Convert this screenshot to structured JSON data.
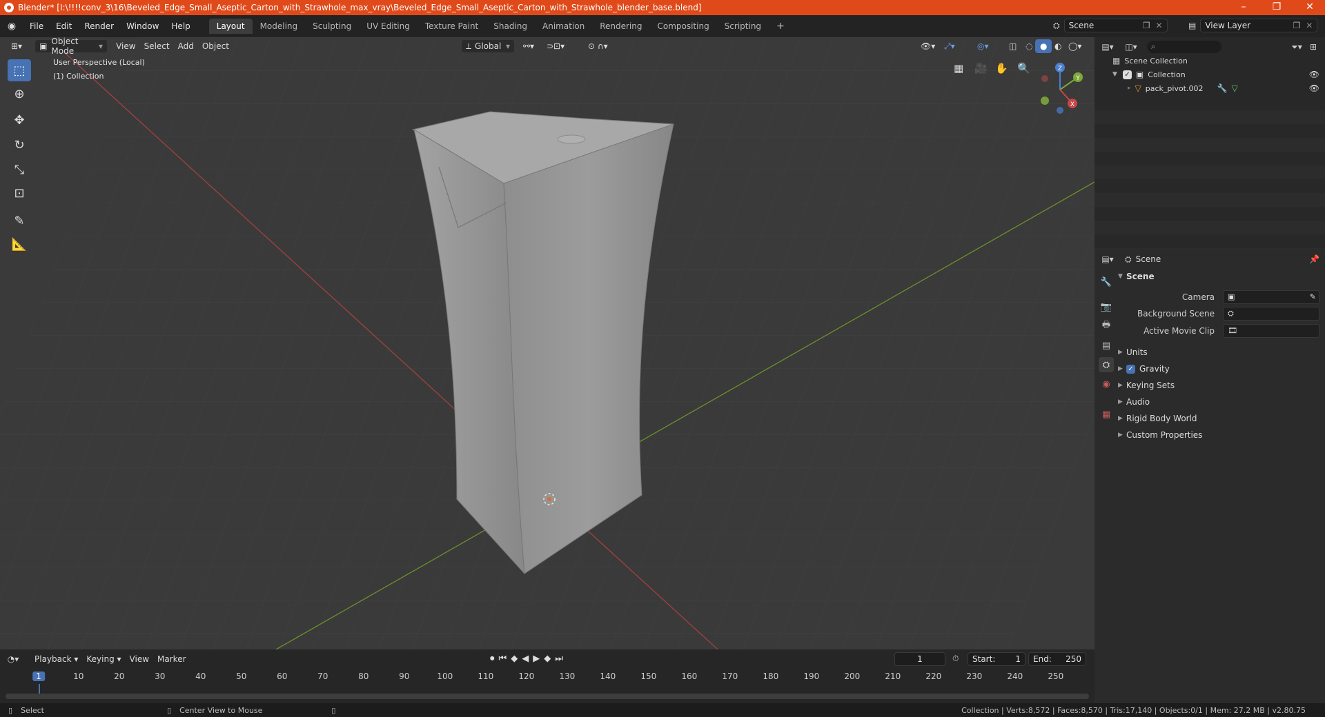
{
  "window": {
    "title": "Blender* [I:\\!!!!conv_3\\16\\Beveled_Edge_Small_Aseptic_Carton_with_Strawhole_max_vray\\Beveled_Edge_Small_Aseptic_Carton_with_Strawhole_blender_base.blend]",
    "minimize": "–",
    "maximize": "❐",
    "close": "✕"
  },
  "menu": [
    "File",
    "Edit",
    "Render",
    "Window",
    "Help"
  ],
  "workspaces": [
    "Layout",
    "Modeling",
    "Sculpting",
    "UV Editing",
    "Texture Paint",
    "Shading",
    "Animation",
    "Rendering",
    "Compositing",
    "Scripting"
  ],
  "active_workspace": "Layout",
  "add_workspace": "+",
  "scene_selector": "Scene",
  "view_layer": "View Layer",
  "viewport": {
    "mode": "Object Mode",
    "menus": [
      "View",
      "Select",
      "Add",
      "Object"
    ],
    "orientation": "Global",
    "info_line1": "User Perspective (Local)",
    "info_line2": "(1) Collection",
    "gizmo": {
      "z": "Z",
      "y": "Y",
      "x": "X"
    }
  },
  "outliner": {
    "root": "Scene Collection",
    "collection": "Collection",
    "object": "pack_pivot.002",
    "search_placeholder": ""
  },
  "properties": {
    "header": "Scene",
    "panel": "Scene",
    "fields": [
      {
        "label": "Camera"
      },
      {
        "label": "Background Scene"
      },
      {
        "label": "Active Movie Clip"
      }
    ],
    "subpanels": [
      "Units",
      "Gravity",
      "Keying Sets",
      "Audio",
      "Rigid Body World",
      "Custom Properties"
    ],
    "gravity_checked": true
  },
  "timeline": {
    "menus": [
      "Playback",
      "Keying",
      "View",
      "Marker"
    ],
    "current_frame": "1",
    "start_label": "Start:",
    "start": "1",
    "end_label": "End:",
    "end": "250",
    "ruler": [
      "1",
      "10",
      "20",
      "30",
      "40",
      "50",
      "60",
      "70",
      "80",
      "90",
      "100",
      "110",
      "120",
      "130",
      "140",
      "150",
      "160",
      "170",
      "180",
      "190",
      "200",
      "210",
      "220",
      "230",
      "240",
      "250"
    ]
  },
  "statusbar": {
    "left1": "Select",
    "left2": "Center View to Mouse",
    "right": "Collection | Verts:8,572 | Faces:8,570 | Tris:17,140 | Objects:0/1 | Mem: 27.2 MB | v2.80.75"
  },
  "colors": {
    "titlebar": "#e04a1a",
    "accent": "#4772b3",
    "axis_x": "#c94646",
    "axis_y": "#7ea93a",
    "axis_z": "#4a7fd0"
  }
}
